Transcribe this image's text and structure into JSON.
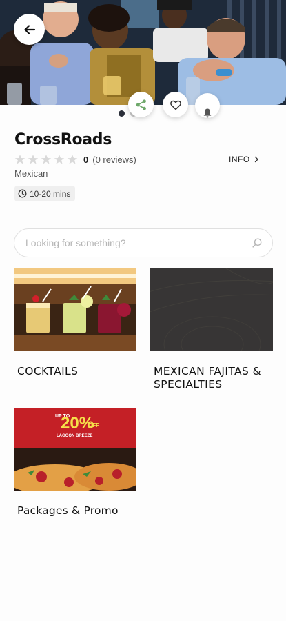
{
  "colors": {
    "accent": "#6ea86a",
    "text": "#111111",
    "muted": "#555555",
    "chip_bg": "#efefef"
  },
  "header": {
    "back_icon": "arrow-left-icon",
    "pager": {
      "count": 3,
      "active_index": 0
    },
    "actions": [
      {
        "name": "share",
        "icon": "share-icon"
      },
      {
        "name": "favorite",
        "icon": "heart-icon"
      },
      {
        "name": "notify",
        "icon": "bell-icon"
      }
    ]
  },
  "restaurant": {
    "name": "CrossRoads",
    "rating": {
      "stars_filled": 0,
      "stars_total": 5,
      "value": "0",
      "reviews": "(0 reviews)"
    },
    "info_label": "INFO",
    "cuisine": "Mexican",
    "delivery_time": "10-20 mins"
  },
  "search": {
    "placeholder": "Looking for something?",
    "value": ""
  },
  "categories": [
    {
      "label": "COCKTAILS"
    },
    {
      "label": "MEXICAN FAJITAS & SPECIALTIES"
    },
    {
      "label": "Packages & Promo",
      "promo_text": {
        "up_to": "UP TO",
        "percent": "20%",
        "off": "OFF",
        "name": "LAGOON BREEZE"
      }
    }
  ]
}
